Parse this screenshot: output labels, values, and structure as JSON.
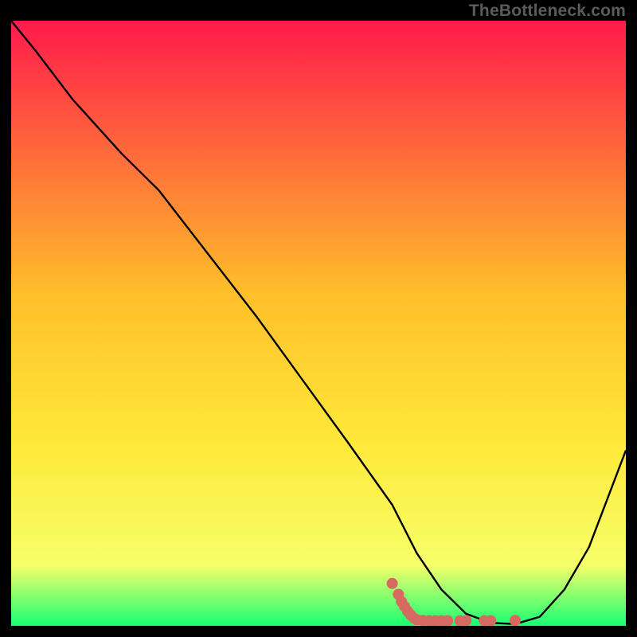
{
  "watermark": "TheBottleneck.com",
  "chart_data": {
    "type": "line",
    "title": "",
    "xlabel": "",
    "ylabel": "",
    "xlim": [
      0,
      100
    ],
    "ylim": [
      0,
      100
    ],
    "gradient_colors": {
      "top": "#ff1a4b",
      "mid_top": "#ffbf2a",
      "mid": "#ffe93a",
      "mid_bottom": "#f6ff6a",
      "bottom": "#19ff73"
    },
    "series": [
      {
        "name": "bottleneck-curve",
        "color": "#000000",
        "x": [
          0,
          4,
          10,
          18,
          24,
          40,
          55,
          62,
          66,
          70,
          74,
          78,
          82,
          86,
          90,
          94,
          100
        ],
        "y": [
          100,
          95,
          87,
          78,
          72,
          51,
          30,
          20,
          12,
          6,
          2,
          0.5,
          0.3,
          1.5,
          6,
          13,
          29
        ]
      }
    ],
    "scatter": {
      "name": "optimal-band",
      "color": "#d66a60",
      "points": [
        {
          "x": 62,
          "y": 7.0
        },
        {
          "x": 63,
          "y": 5.2
        },
        {
          "x": 63.5,
          "y": 4.0
        },
        {
          "x": 64,
          "y": 3.2
        },
        {
          "x": 64.5,
          "y": 2.4
        },
        {
          "x": 65,
          "y": 1.8
        },
        {
          "x": 65.5,
          "y": 1.3
        },
        {
          "x": 66,
          "y": 1.0
        },
        {
          "x": 67,
          "y": 0.9
        },
        {
          "x": 68,
          "y": 0.85
        },
        {
          "x": 69,
          "y": 0.85
        },
        {
          "x": 70,
          "y": 0.85
        },
        {
          "x": 71,
          "y": 0.85
        },
        {
          "x": 73,
          "y": 0.85
        },
        {
          "x": 74,
          "y": 0.85
        },
        {
          "x": 77,
          "y": 0.85
        },
        {
          "x": 78,
          "y": 0.85
        },
        {
          "x": 82,
          "y": 0.9
        }
      ]
    }
  }
}
